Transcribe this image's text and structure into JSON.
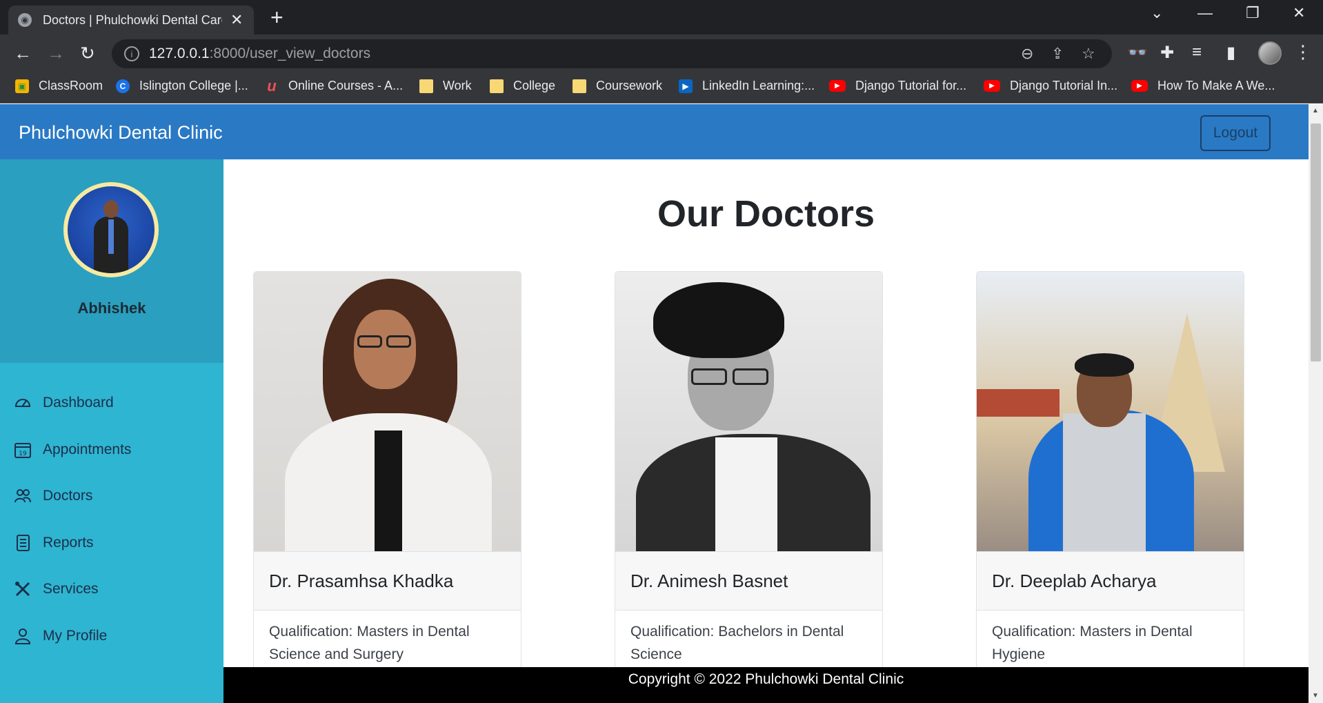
{
  "browser": {
    "tab_title": "Doctors | Phulchowki Dental Care",
    "url_host": "127.0.0.1",
    "url_path": ":8000/user_view_doctors",
    "bookmarks": [
      {
        "label": "ClassRoom",
        "icon": "classroom-icon"
      },
      {
        "label": "Islington College |...",
        "icon": "islington-icon"
      },
      {
        "label": "Online Courses - A...",
        "icon": "udemy-icon"
      },
      {
        "label": "Work",
        "icon": "folder-icon"
      },
      {
        "label": "College",
        "icon": "folder-icon"
      },
      {
        "label": "Coursework",
        "icon": "folder-icon"
      },
      {
        "label": "LinkedIn Learning:...",
        "icon": "linkedin-icon"
      },
      {
        "label": "Django Tutorial for...",
        "icon": "youtube-icon"
      },
      {
        "label": "Django Tutorial In...",
        "icon": "youtube-icon"
      },
      {
        "label": "How To Make A We...",
        "icon": "youtube-icon"
      }
    ]
  },
  "navbar": {
    "brand": "Phulchowki Dental Clinic",
    "logout_label": "Logout"
  },
  "sidebar": {
    "user_name": "Abhishek",
    "items": [
      {
        "label": "Dashboard",
        "icon": "speedometer-icon"
      },
      {
        "label": "Appointments",
        "icon": "calendar-icon"
      },
      {
        "label": "Doctors",
        "icon": "people-icon"
      },
      {
        "label": "Reports",
        "icon": "report-icon"
      },
      {
        "label": "Services",
        "icon": "tools-icon"
      },
      {
        "label": "My Profile",
        "icon": "person-icon"
      }
    ]
  },
  "main": {
    "heading": "Our Doctors",
    "doctors": [
      {
        "name": "Dr. Prasamhsa Khadka",
        "qualification": "Qualification: Masters in Dental Science and Surgery"
      },
      {
        "name": "Dr. Animesh Basnet",
        "qualification": "Qualification: Bachelors in Dental Science"
      },
      {
        "name": "Dr. Deeplab Acharya",
        "qualification": "Qualification: Masters in Dental Hygiene"
      }
    ]
  },
  "footer": {
    "copyright": "Copyright © 2022 Phulchowki Dental Clinic"
  },
  "colors": {
    "navbar": "#2a79c4",
    "sidebar": "#2eb5d1",
    "sidebar_profile": "#2a9fbf",
    "footer": "#000000"
  }
}
